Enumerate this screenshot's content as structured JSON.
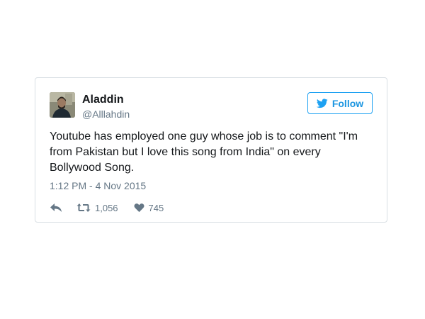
{
  "tweet": {
    "author": {
      "name": "Aladdin",
      "handle": "@Alllahdin",
      "avatar_icon": "user-avatar-photo"
    },
    "follow_label": "Follow",
    "text": "Youtube has employed one guy whose job is to comment \"I'm from Pakistan but I love this song from India\" on every Bollywood Song.",
    "timestamp": "1:12 PM - 4 Nov 2015",
    "retweets": "1,056",
    "likes": "745"
  },
  "colors": {
    "accent": "#1da1f2",
    "text": "#14171a",
    "muted": "#657786",
    "border": "#d9dfe4"
  },
  "icons": {
    "follow": "twitter-bird-icon",
    "reply": "reply-icon",
    "retweet": "retweet-icon",
    "like": "heart-icon"
  }
}
